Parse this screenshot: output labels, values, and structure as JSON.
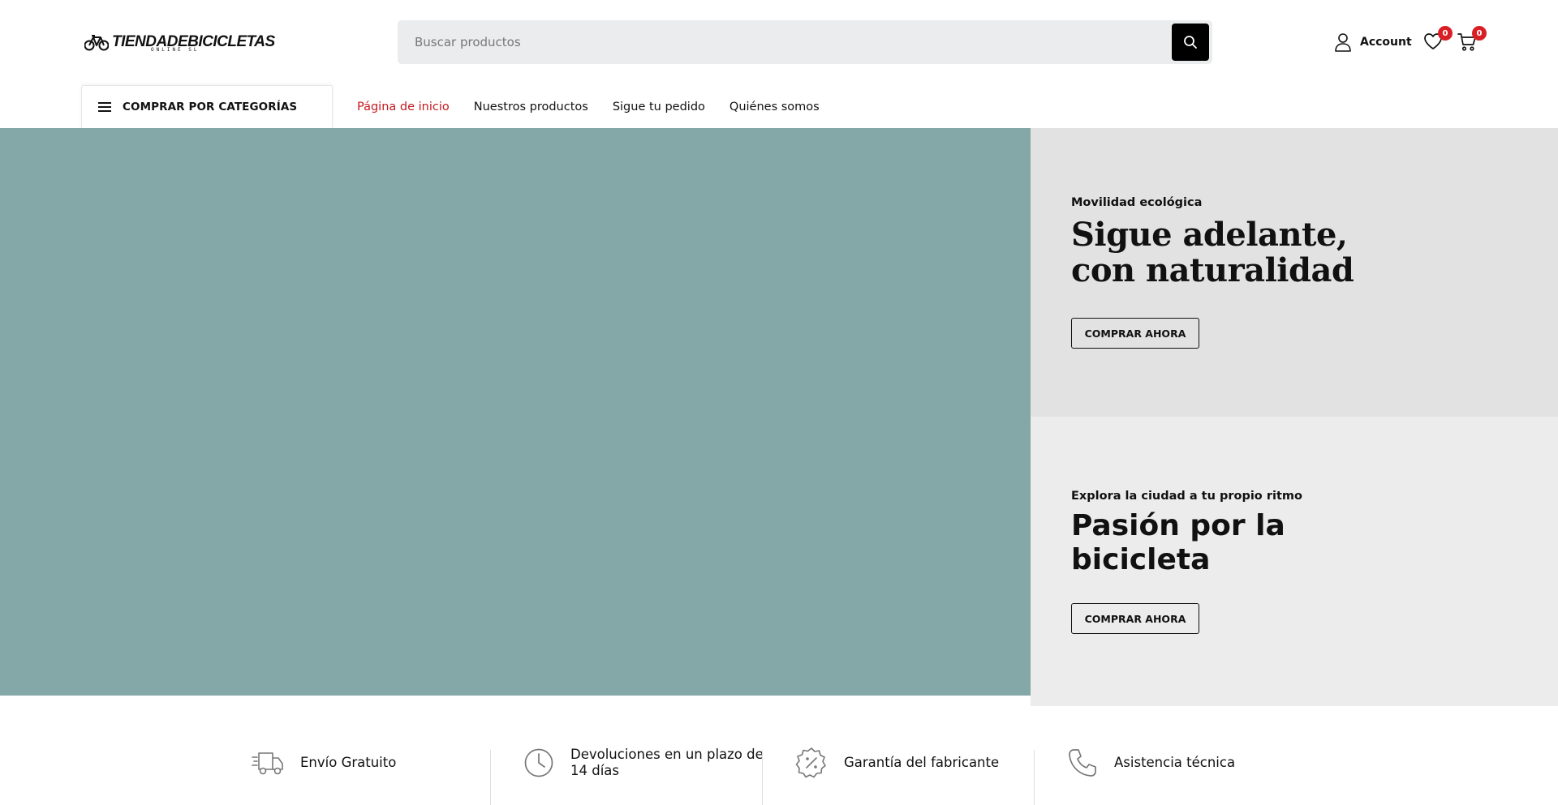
{
  "header": {
    "logo": {
      "text": "TIENDADEBICICLETAS",
      "subtext": "ONLINE SL"
    },
    "search": {
      "placeholder": "Buscar productos",
      "value": ""
    },
    "account_label": "Account",
    "wishlist_count": "0",
    "cart_count": "0"
  },
  "categories_button": {
    "label": "COMPRAR POR CATEGORÍAS"
  },
  "nav": {
    "items": [
      {
        "label": "Página de inicio",
        "active": true
      },
      {
        "label": "Nuestros productos",
        "active": false
      },
      {
        "label": "Sigue tu pedido",
        "active": false
      },
      {
        "label": "Quiénes somos",
        "active": false
      }
    ]
  },
  "banners": [
    {
      "subtitle": "Movilidad ecológica",
      "title_line1": "Sigue adelante,",
      "title_line2": "con naturalidad",
      "button": "COMPRAR AHORA"
    },
    {
      "subtitle": "Explora la ciudad a tu propio ritmo",
      "title_line1": "Pasión por la",
      "title_line2": "bicicleta",
      "button": "COMPRAR AHORA"
    }
  ],
  "features": [
    {
      "icon": "truck-icon",
      "label_line1": "Envío Gratuito",
      "label_line2": ""
    },
    {
      "icon": "clock-icon",
      "label_line1": "Devoluciones en un plazo de",
      "label_line2": "14 días"
    },
    {
      "icon": "discount-badge-icon",
      "label_line1": "Garantía del fabricante",
      "label_line2": ""
    },
    {
      "icon": "phone-icon",
      "label_line1": "Asistencia técnica",
      "label_line2": ""
    }
  ],
  "colors": {
    "accent_red": "#c4191f",
    "badge_red": "#d91f26",
    "hero_teal": "#84a7a8",
    "banner_gray_1": "#e2e2e3",
    "banner_gray_2": "#ececed",
    "search_bg": "#ebeced"
  }
}
